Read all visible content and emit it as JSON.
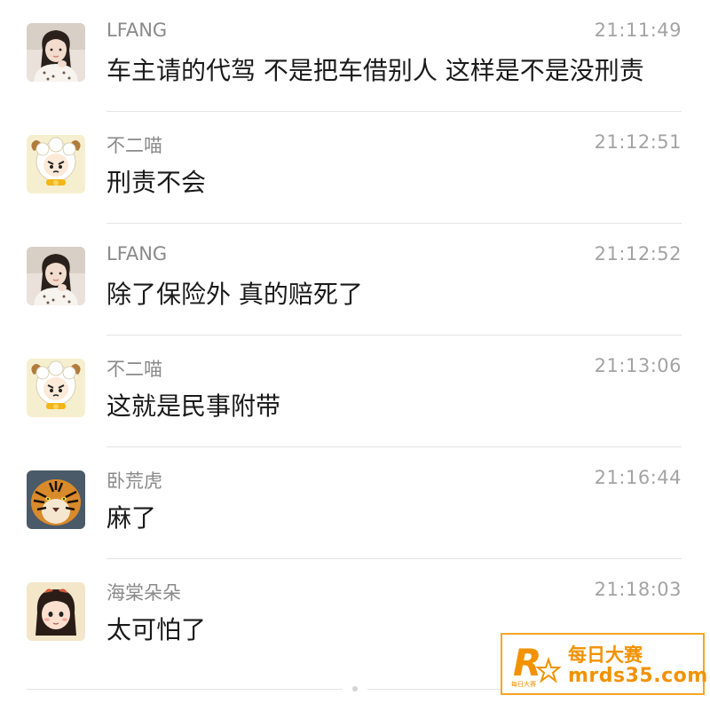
{
  "messages": [
    {
      "sender": "LFANG",
      "time": "21:11:49",
      "text": "车主请的代驾 不是把车借别人 这样是不是没刑责",
      "avatar": "girl-photo-avatar"
    },
    {
      "sender": "不二喵",
      "time": "21:12:51",
      "text": "刑责不会",
      "avatar": "sheep-cartoon-avatar"
    },
    {
      "sender": "LFANG",
      "time": "21:12:52",
      "text": "除了保险外 真的赔死了",
      "avatar": "girl-photo-avatar"
    },
    {
      "sender": "不二喵",
      "time": "21:13:06",
      "text": "这就是民事附带",
      "avatar": "sheep-cartoon-avatar"
    },
    {
      "sender": "卧荒虎",
      "time": "21:16:44",
      "text": "麻了",
      "avatar": "tiger-photo-avatar"
    },
    {
      "sender": "海棠朵朵",
      "time": "21:18:03",
      "text": "太可怕了",
      "avatar": "cartoon-girl-avatar"
    }
  ],
  "watermark": {
    "title": "每日大赛",
    "url": "mrds35.com",
    "logo_letter": "R",
    "logo_caption": "每日大赛"
  },
  "colors": {
    "sender": "#8a8a8a",
    "time": "#a3a3a3",
    "text": "#1a1a1a",
    "divider": "#e3e3e3",
    "watermark_accent": "#f29200"
  }
}
